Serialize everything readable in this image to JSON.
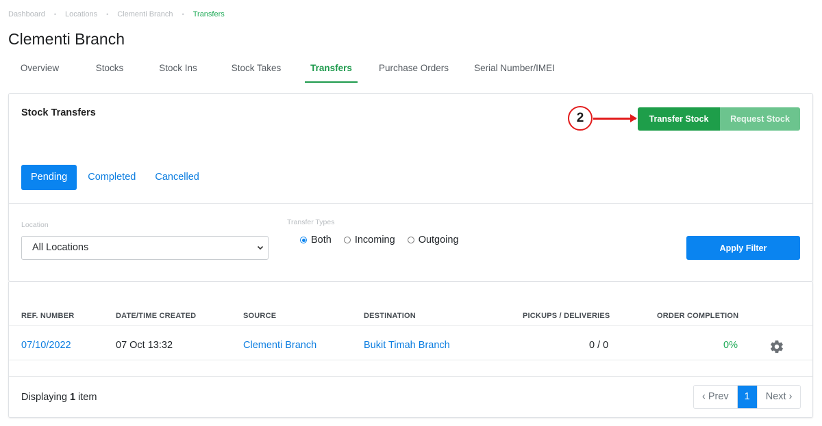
{
  "breadcrumb": [
    "Dashboard",
    "Locations",
    "Clementi Branch",
    "Transfers"
  ],
  "page_title": "Clementi Branch",
  "tabs": [
    "Overview",
    "Stocks",
    "Stock Ins",
    "Stock Takes",
    "Transfers",
    "Purchase Orders",
    "Serial Number/IMEI"
  ],
  "active_tab": "Transfers",
  "card": {
    "title": "Stock Transfers",
    "transfer_button": "Transfer Stock",
    "request_button": "Request Stock",
    "annotation_number": "2"
  },
  "status_tabs": [
    "Pending",
    "Completed",
    "Cancelled"
  ],
  "filters": {
    "location_label": "Location",
    "location_value": "All Locations",
    "types_label": "Transfer Types",
    "types": [
      "Both",
      "Incoming",
      "Outgoing"
    ],
    "selected_type": "Both",
    "apply_label": "Apply Filter"
  },
  "table": {
    "headers": [
      "REF. NUMBER",
      "DATE/TIME CREATED",
      "SOURCE",
      "DESTINATION",
      "PICKUPS / DELIVERIES",
      "ORDER COMPLETION"
    ],
    "rows": [
      {
        "ref": "07/10/2022",
        "created": "07 Oct 13:32",
        "source": "Clementi Branch",
        "destination": "Bukit Timah Branch",
        "pickups": "0 / 0",
        "completion": "0%"
      }
    ]
  },
  "footer": {
    "displaying_prefix": "Displaying",
    "count": "1",
    "suffix": "item"
  },
  "pagination": {
    "prev": "‹ Prev",
    "current": "1",
    "next": "Next ›"
  },
  "colors": {
    "green": "#1e9e4a",
    "blue": "#0a84f0",
    "annotation_red": "#e21b1b"
  }
}
